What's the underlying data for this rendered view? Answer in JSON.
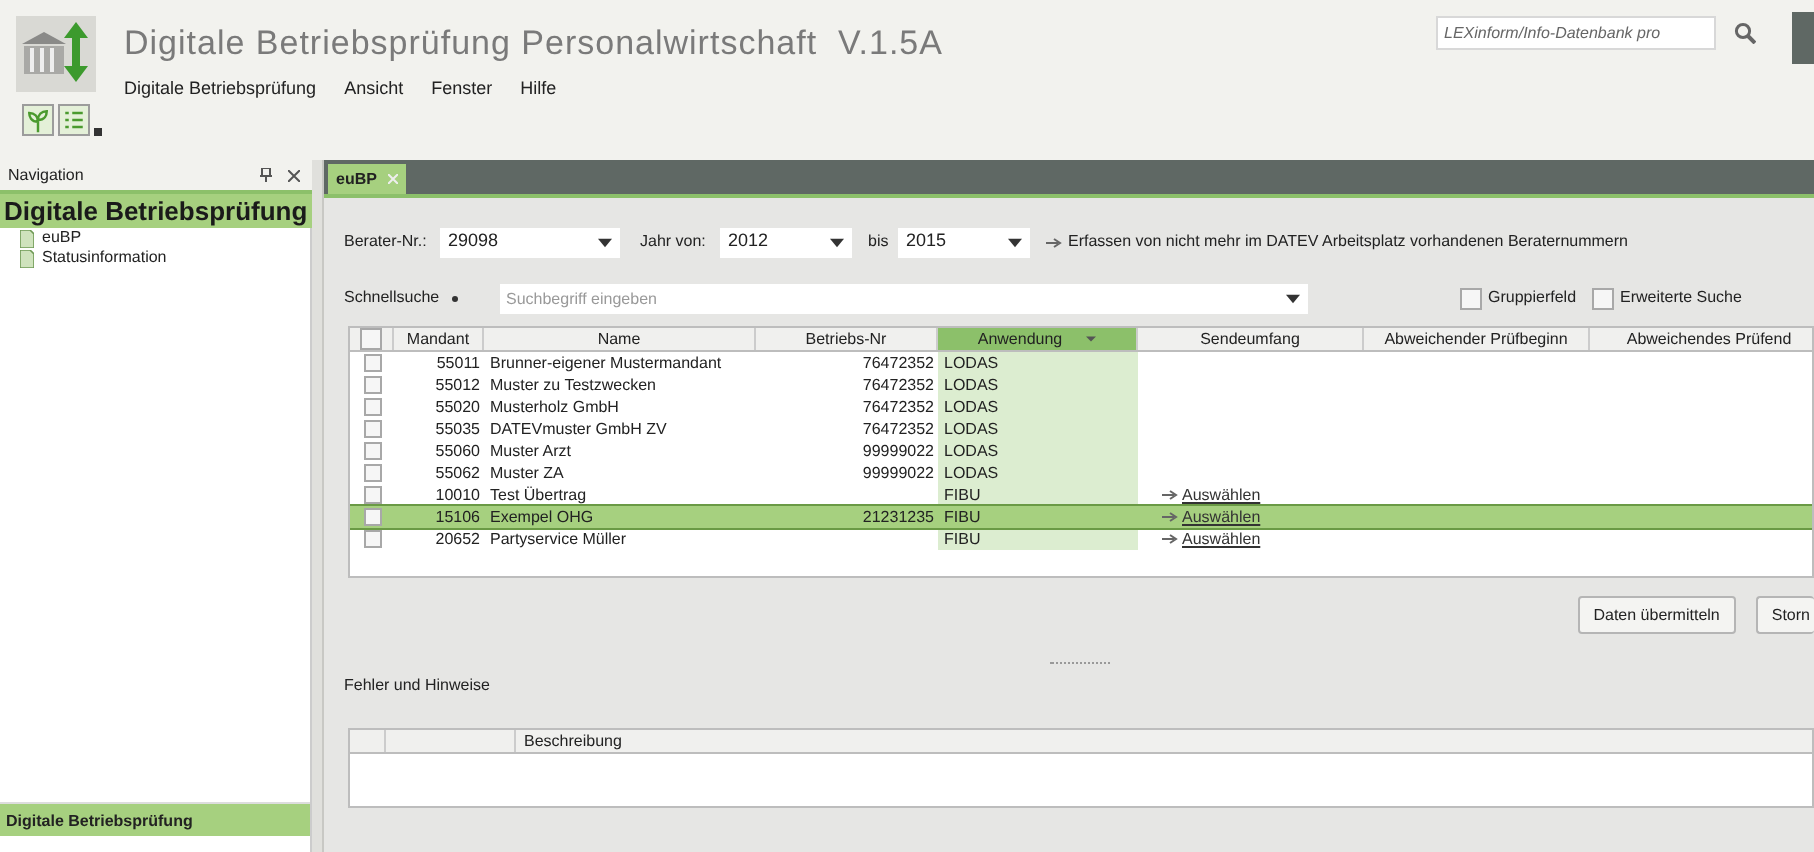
{
  "window": {
    "title": "Digitale Betriebsprüfung Personalwirtschaft  V.1.5A"
  },
  "menu": [
    "Digitale Betriebsprüfung",
    "Ansicht",
    "Fenster",
    "Hilfe"
  ],
  "search": {
    "placeholder": "LEXinform/Info-Datenbank pro"
  },
  "navigation": {
    "title": "Navigation",
    "heading": "Digitale Betriebsprüfung",
    "items": [
      {
        "label": "euBP",
        "selected": false
      },
      {
        "label": "Statusinformation",
        "selected": false
      }
    ],
    "footer": "Digitale Betriebsprüfung"
  },
  "tabs": [
    {
      "label": "euBP",
      "selected": true
    }
  ],
  "filters": {
    "berater_label": "Berater-Nr.:",
    "berater": "29098",
    "jahr_label": "Jahr von:",
    "jahr_von": "2012",
    "bis_label": "bis",
    "bis": "2015",
    "hint": "Erfassen von nicht mehr im DATEV Arbeitsplatz vorhandenen Beraternummern"
  },
  "quicksearch": {
    "label": "Schnellsuche",
    "placeholder": "Suchbegriff eingeben",
    "options": [
      {
        "label": "Gruppierfeld",
        "checked": false
      },
      {
        "label": "Erweiterte Suche",
        "checked": false
      }
    ]
  },
  "table": {
    "select_all_checked": false,
    "columns": [
      {
        "label": "Mandant",
        "sorted": false
      },
      {
        "label": "Name",
        "sorted": false
      },
      {
        "label": "Betriebs-Nr",
        "sorted": false
      },
      {
        "label": "Anwendung",
        "sorted": true
      },
      {
        "label": "Sendeumfang",
        "sorted": false
      },
      {
        "label": "Abweichender Prüfbeginn",
        "sorted": false
      },
      {
        "label": "Abweichendes Prüfend",
        "sorted": false
      }
    ],
    "rows": [
      {
        "checked": false,
        "selected": false,
        "mandant": "55011",
        "name": "Brunner-eigener Mustermandant",
        "betriebs_nr": "76472352",
        "anwendung": "LODAS"
      },
      {
        "checked": false,
        "selected": false,
        "mandant": "55012",
        "name": "Muster zu Testzwecken",
        "betriebs_nr": "76472352",
        "anwendung": "LODAS"
      },
      {
        "checked": false,
        "selected": false,
        "mandant": "55020",
        "name": "Musterholz GmbH",
        "betriebs_nr": "76472352",
        "anwendung": "LODAS"
      },
      {
        "checked": false,
        "selected": false,
        "mandant": "55035",
        "name": "DATEVmuster GmbH ZV",
        "betriebs_nr": "76472352",
        "anwendung": "LODAS"
      },
      {
        "checked": false,
        "selected": false,
        "mandant": "55060",
        "name": "Muster Arzt",
        "betriebs_nr": "99999022",
        "anwendung": "LODAS"
      },
      {
        "checked": false,
        "selected": false,
        "mandant": "55062",
        "name": "Muster ZA",
        "betriebs_nr": "99999022",
        "anwendung": "LODAS"
      },
      {
        "checked": false,
        "selected": false,
        "mandant": "10010",
        "name": "Test Übertrag",
        "anwendung": "FIBU",
        "link": "Auswählen"
      },
      {
        "checked": false,
        "selected": true,
        "mandant": "15106",
        "name": "Exempel OHG",
        "betriebs_nr": "21231235",
        "anwendung": "FIBU",
        "link": "Auswählen"
      },
      {
        "checked": false,
        "selected": false,
        "mandant": "20652",
        "name": "Partyservice Müller",
        "anwendung": "FIBU",
        "link": "Auswählen"
      }
    ]
  },
  "buttons": [
    "Daten übermitteln",
    "Storn"
  ],
  "errors": {
    "title": "Fehler und Hinweise",
    "columns": [
      "Beschreibung"
    ]
  }
}
